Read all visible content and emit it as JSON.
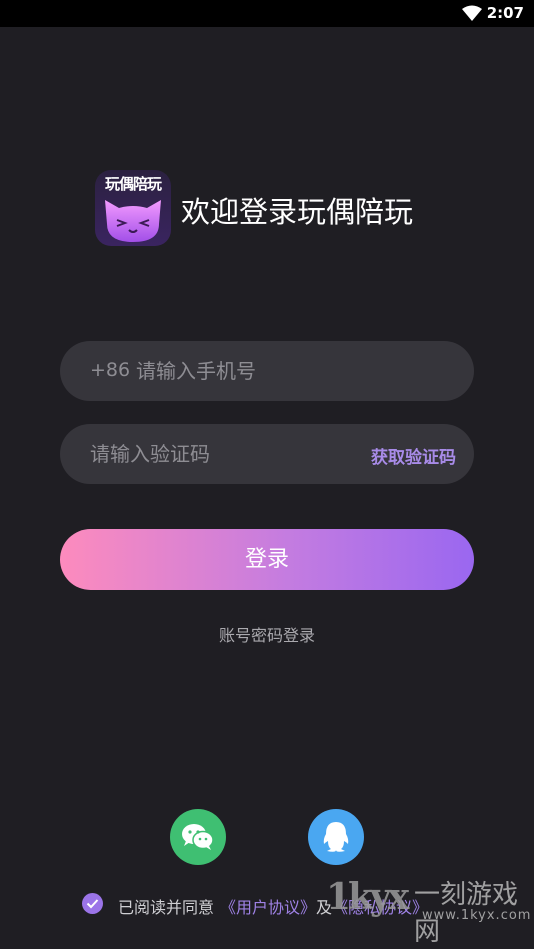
{
  "status_bar": {
    "time": "2:07",
    "wifi_icon": "wifi-icon"
  },
  "header": {
    "logo_text": "玩偶陪玩",
    "title": "欢迎登录玩偶陪玩"
  },
  "phone_field": {
    "prefix": "+86",
    "placeholder": "请输入手机号",
    "value": ""
  },
  "code_field": {
    "placeholder": "请输入验证码",
    "value": "",
    "get_code_label": "获取验证码"
  },
  "login_button": {
    "label": "登录"
  },
  "password_login_link": "账号密码登录",
  "social_login": [
    {
      "name": "wechat",
      "icon": "wechat-icon",
      "color": "#3fbf72"
    },
    {
      "name": "qq",
      "icon": "qq-icon",
      "color": "#4aa7f1"
    }
  ],
  "agreement": {
    "checked": true,
    "prefix": "已阅读并同意",
    "user_agreement": "《用户协议》",
    "connector": "及",
    "privacy_policy": "《隐私协议》"
  },
  "watermark": {
    "logo": "1kyx",
    "name": "一刻游戏网",
    "url": "www.1kyx.com"
  },
  "colors": {
    "background": "#1f1e23",
    "input_bg": "#36353b",
    "accent": "#9b74e8",
    "gradient_start": "#fd8bbd",
    "gradient_end": "#9a67f0"
  }
}
